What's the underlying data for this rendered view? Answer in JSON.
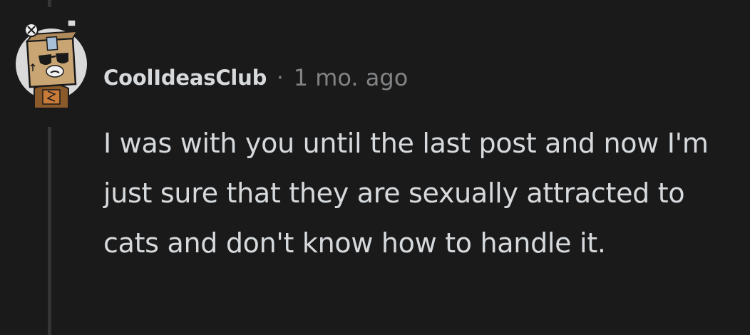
{
  "comment": {
    "author": "CoolIdeasClub",
    "separator": "·",
    "timestamp": "1 mo. ago",
    "body": "I was with you until the last post and now I'm just sure that they are sexually attracted to cats and don't know how to handle it."
  },
  "avatar": {
    "icon": "box-head-snoo-avatar-icon"
  },
  "colors": {
    "background": "#1a1a1b",
    "text": "#d7dadc",
    "meta": "#818384",
    "thread_line": "#343536"
  }
}
